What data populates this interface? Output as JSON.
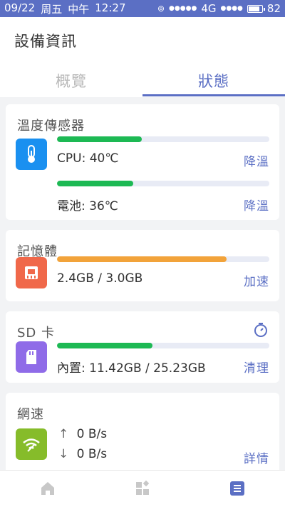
{
  "status_bar": {
    "date": "09/22",
    "weekday": "周五",
    "ampm": "中午",
    "time": "12:27",
    "signal_left": "●●●●●",
    "network": "4G",
    "signal_right": "●●●●",
    "battery": "82"
  },
  "header": {
    "title": "設備資訊",
    "tabs": [
      {
        "label": "概覽",
        "active": false
      },
      {
        "label": "狀態",
        "active": true
      }
    ]
  },
  "temperature": {
    "title": "溫度傳感器",
    "rows": [
      {
        "value": "CPU: 40℃",
        "action": "降溫",
        "progress": 0.4
      },
      {
        "value": "電池: 36℃",
        "action": "降溫",
        "progress": 0.36
      }
    ],
    "icon": "thermometer-icon"
  },
  "memory": {
    "title": "記憶體",
    "value": "2.4GB / 3.0GB",
    "action": "加速",
    "progress": 0.8,
    "icon": "memory-chip-icon"
  },
  "sdcard": {
    "title": "SD 卡",
    "value": "內置: 11.42GB / 25.23GB",
    "action": "清理",
    "progress": 0.45,
    "icon": "sd-card-icon"
  },
  "network": {
    "title": "網速",
    "upload": "0 B/s",
    "download": "0 B/s",
    "action": "詳情",
    "icon": "wifi-icon"
  },
  "colors": {
    "accent": "#5b6fc4",
    "green": "#1db954",
    "orange": "#f2a33a",
    "blue_icon": "#1a90f0",
    "red_icon": "#f0684a",
    "purple_icon": "#8f6be8",
    "lime_icon": "#86bc2a"
  },
  "bottom_nav": [
    "home-icon",
    "apps-icon",
    "list-icon"
  ]
}
